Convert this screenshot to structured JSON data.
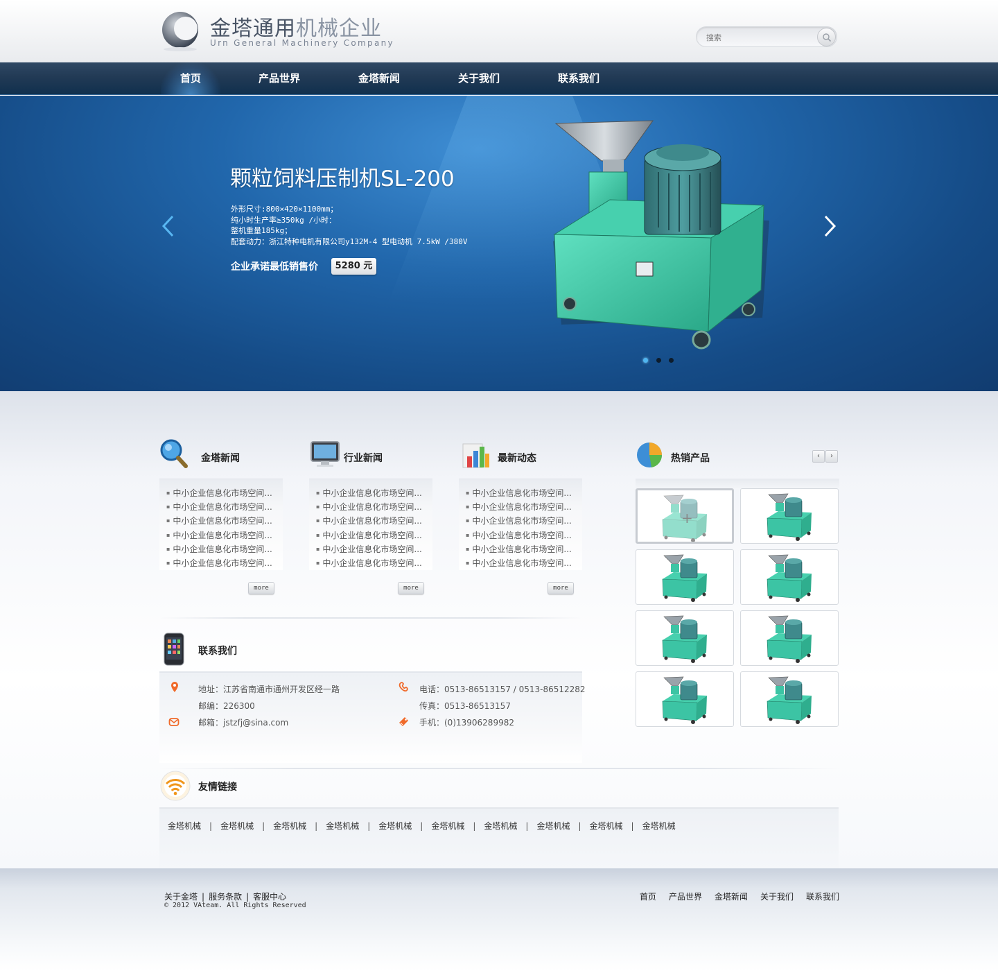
{
  "header": {
    "logo_cn_dark": "金塔通用",
    "logo_cn_light": "机械企业",
    "logo_en": "Urn General Machinery Company",
    "search_placeholder": "搜索"
  },
  "nav": [
    "首页",
    "产品世界",
    "金塔新闻",
    "关于我们",
    "联系我们"
  ],
  "banner": {
    "title": "颗粒饲料压制机SL-200",
    "specs": [
      "外形尺寸:800×420×1100mm；",
      "纯小时生产率≥350kg /小时：",
      "整机重量185kg；",
      "配套动力：浙江特种电机有限公司y132M-4 型电动机  7.5kW /380V"
    ],
    "promise": "企业承诺最低销售价",
    "price": "5280 元",
    "slide_count": 3,
    "active_slide": 1
  },
  "columns": [
    {
      "title": "金塔新闻",
      "icon": "magnifier-icon",
      "items": [
        "中小企业信息化市场空间...",
        "中小企业信息化市场空间...",
        "中小企业信息化市场空间...",
        "中小企业信息化市场空间...",
        "中小企业信息化市场空间...",
        "中小企业信息化市场空间..."
      ],
      "more": "more"
    },
    {
      "title": "行业新闻",
      "icon": "monitor-icon",
      "items": [
        "中小企业信息化市场空间...",
        "中小企业信息化市场空间...",
        "中小企业信息化市场空间...",
        "中小企业信息化市场空间...",
        "中小企业信息化市场空间...",
        "中小企业信息化市场空间..."
      ],
      "more": "more"
    },
    {
      "title": "最新动态",
      "icon": "bar-chart-icon",
      "items": [
        "中小企业信息化市场空间...",
        "中小企业信息化市场空间...",
        "中小企业信息化市场空间...",
        "中小企业信息化市场空间...",
        "中小企业信息化市场空间...",
        "中小企业信息化市场空间..."
      ],
      "more": "more"
    }
  ],
  "hot": {
    "title": "热销产品",
    "icon": "pie-chart-icon",
    "prev": "‹",
    "next": "›",
    "count": 8
  },
  "contact": {
    "title": "联系我们",
    "address": "地址：江苏省南通市通州开发区经一路",
    "zip": "邮编：226300",
    "email": "邮箱：jstzfj@sina.com",
    "phone": "电话：0513-86513157  / 0513-86512282",
    "fax": "传真：0513-86513157",
    "mobile": "手机：(0)13906289982"
  },
  "links": {
    "title": "友情链接",
    "items": [
      "金塔机械",
      "金塔机械",
      "金塔机械",
      "金塔机械",
      "金塔机械",
      "金塔机械",
      "金塔机械",
      "金塔机械",
      "金塔机械",
      "金塔机械"
    ]
  },
  "footer": {
    "left_links": [
      "关于金塔",
      "服务条款",
      "客服中心"
    ],
    "copyright": "© 2012 VAteam. All Rights Reserved",
    "nav": [
      "首页",
      "产品世界",
      "金塔新闻",
      "关于我们",
      "联系我们"
    ]
  },
  "colors": {
    "nav_bg": "#223a55",
    "banner_bg": "#2167ac",
    "machine_green": "#3cc4a4"
  }
}
